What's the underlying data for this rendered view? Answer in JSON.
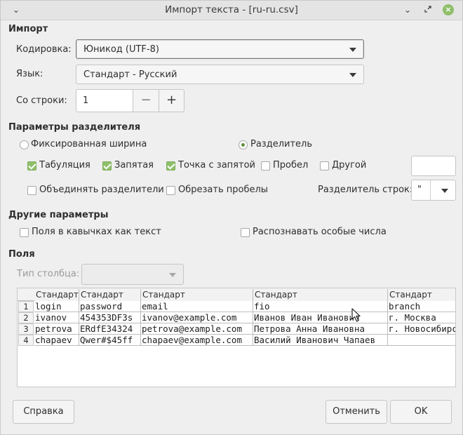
{
  "window": {
    "title": "Импорт текста - [ru-ru.csv]",
    "menu_icon": "chevron-down-icon",
    "minimize_icon": "minimize-icon",
    "restore_icon": "restore-icon",
    "close_icon": "close-icon"
  },
  "import": {
    "section_title": "Импорт",
    "encoding_label": "Кодировка:",
    "encoding_value": "Юникод (UTF-8)",
    "language_label": "Язык:",
    "language_value": "Стандарт - Русский",
    "from_row_label": "Со строки:",
    "from_row_value": "1",
    "minus": "−",
    "plus": "+"
  },
  "separator": {
    "section_title": "Параметры разделителя",
    "fixed_width_label": "Фиксированная ширина",
    "fixed_width_selected": false,
    "separated_label": "Разделитель",
    "separated_selected": true,
    "options": [
      {
        "label": "Табуляция",
        "checked": true
      },
      {
        "label": "Запятая",
        "checked": true
      },
      {
        "label": "Точка с запятой",
        "checked": true
      },
      {
        "label": "Пробел",
        "checked": false
      },
      {
        "label": "Другой",
        "checked": false
      }
    ],
    "merge_label": "Объединять разделители",
    "merge_checked": false,
    "trim_label": "Обрезать пробелы",
    "trim_checked": false,
    "string_delimiter_label": "Разделитель строк:",
    "string_delimiter_value": "\""
  },
  "other": {
    "section_title": "Другие параметры",
    "quoted_as_text_label": "Поля в кавычках как текст",
    "quoted_as_text_checked": false,
    "detect_special_label": "Распознавать особые числа",
    "detect_special_checked": false
  },
  "fields": {
    "section_title": "Поля",
    "column_type_label": "Тип столбца:",
    "column_type_value": "",
    "headers": [
      "Стандарт",
      "Стандарт",
      "Стандарт",
      "Стандарт",
      "Стандарт"
    ],
    "rows": [
      {
        "num": "1",
        "cells": [
          "login",
          "password",
          "email",
          "fio",
          "branch"
        ]
      },
      {
        "num": "2",
        "cells": [
          "ivanov",
          "454353DF3s",
          "ivanov@example.com",
          "Иванов Иван Иванович",
          "г. Москва"
        ]
      },
      {
        "num": "3",
        "cells": [
          "petrova",
          "ERdfE34324",
          "petrova@example.com",
          "Петрова Анна Ивановна",
          "г. Новосибирск"
        ]
      },
      {
        "num": "4",
        "cells": [
          "chapaev",
          "Qwer#$45ff",
          "chapaev@example.com",
          "Василий Иванович Чапаев",
          ""
        ]
      }
    ]
  },
  "buttons": {
    "help": "Справка",
    "cancel": "Отменить",
    "ok": "OK"
  }
}
